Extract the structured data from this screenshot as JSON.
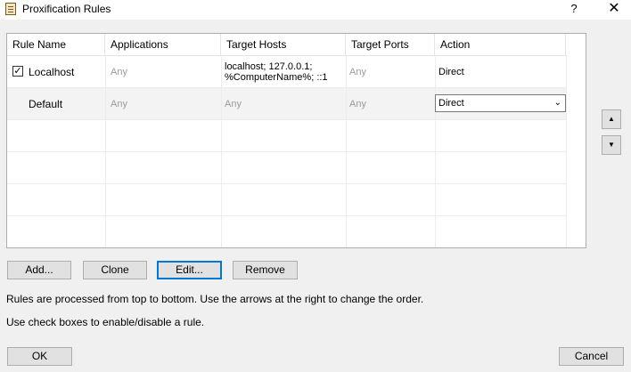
{
  "window": {
    "title": "Proxification Rules",
    "help": "?",
    "close": "✕"
  },
  "table": {
    "columns": [
      "Rule Name",
      "Applications",
      "Target Hosts",
      "Target Ports",
      "Action"
    ],
    "rows": [
      {
        "checked": true,
        "name": "Localhost",
        "applications": "Any",
        "hosts_line1": "localhost; 127.0.0.1;",
        "hosts_line2": "%ComputerName%; ::1",
        "ports": "Any",
        "action": "Direct"
      },
      {
        "checked": null,
        "name": "Default",
        "applications": "Any",
        "hosts": "Any",
        "ports": "Any",
        "action": "Direct"
      }
    ]
  },
  "side": {
    "up": "▲",
    "down": "▼"
  },
  "buttons": {
    "add": "Add...",
    "clone": "Clone",
    "edit": "Edit...",
    "remove": "Remove",
    "ok": "OK",
    "cancel": "Cancel"
  },
  "info": {
    "line1": "Rules are processed from top to bottom. Use the arrows at the right to change the order.",
    "line2": "Use check boxes to enable/disable a rule."
  },
  "icons": {
    "app": "rules-list-icon",
    "dropdown": "chevron-down-icon"
  }
}
